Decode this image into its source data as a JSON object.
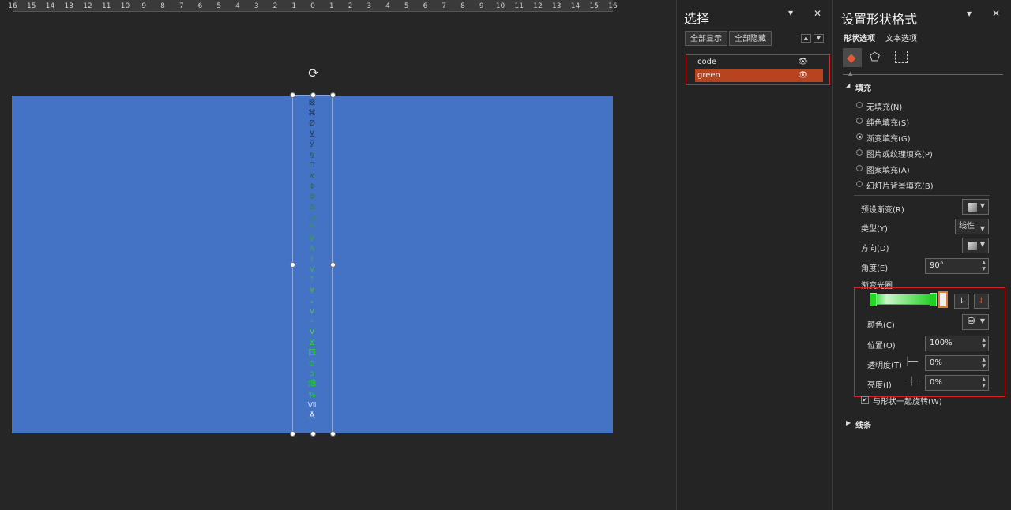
{
  "ruler": {
    "ticks": [
      "16",
      "15",
      "14",
      "13",
      "12",
      "11",
      "10",
      "9",
      "8",
      "7",
      "6",
      "5",
      "4",
      "3",
      "2",
      "1",
      "0",
      "1",
      "2",
      "3",
      "4",
      "5",
      "6",
      "7",
      "8",
      "9",
      "10",
      "11",
      "12",
      "13",
      "14",
      "15",
      "16"
    ]
  },
  "slide": {
    "background_color": "#4472c4",
    "glyphs": [
      {
        "t": "⊠",
        "c": "#1a3355"
      },
      {
        "t": "⌘",
        "c": "#1a3355"
      },
      {
        "t": "Ø",
        "c": "#1a3355"
      },
      {
        "t": "⊻",
        "c": "#1b3d55"
      },
      {
        "t": "Ӱ",
        "c": "#1e4a55"
      },
      {
        "t": "§",
        "c": "#225a55"
      },
      {
        "t": "Π",
        "c": "#245f55"
      },
      {
        "t": "ϰ",
        "c": "#276655"
      },
      {
        "t": "Φ",
        "c": "#2b7055"
      },
      {
        "t": "Φ",
        "c": "#2f7a55"
      },
      {
        "t": "Δ",
        "c": "#338255"
      },
      {
        "t": "□",
        "c": "#378a55"
      },
      {
        "t": "Ⴕ",
        "c": "#3b9455"
      },
      {
        "t": "Ψ",
        "c": "#3f9c55"
      },
      {
        "t": "A",
        "c": "#43a355"
      },
      {
        "t": "Ι",
        "c": "#46a955"
      },
      {
        "t": "V",
        "c": "#4aae55"
      },
      {
        "t": "ᛉ",
        "c": "#4eb455"
      },
      {
        "t": "¥",
        "c": "#52b855"
      },
      {
        "t": "ₓ",
        "c": "#55bd55"
      },
      {
        "t": "v",
        "c": "#58c055"
      },
      {
        "t": "◦",
        "c": "#5bc455"
      },
      {
        "t": "V",
        "c": "#5ec755"
      },
      {
        "t": "Ϫ",
        "c": "#3cc93c"
      },
      {
        "t": "四",
        "c": "#30cc30"
      },
      {
        "t": "⊙",
        "c": "#28cf28"
      },
      {
        "t": "ᴐ",
        "c": "#22d222"
      },
      {
        "t": "畑",
        "c": "#1cd51c"
      },
      {
        "t": "%",
        "c": "#18d818"
      },
      {
        "t": "Ⅶ",
        "c": "#c8d8ff"
      },
      {
        "t": "Å",
        "c": "#e0e8ff"
      }
    ]
  },
  "selection_pane": {
    "title": "选择",
    "dropdown_icon": "▼",
    "close_icon": "✕",
    "show_all": "全部显示",
    "hide_all": "全部隐藏",
    "layers": [
      {
        "name": "code",
        "selected": false
      },
      {
        "name": "green",
        "selected": true
      }
    ],
    "selected_color": "#b8441f"
  },
  "format_pane": {
    "title": "设置形状格式",
    "tabs": [
      "形状选项",
      "文本选项"
    ],
    "fill_section": "填充",
    "fill_options": [
      {
        "label": "无填充(N)",
        "checked": false
      },
      {
        "label": "纯色填充(S)",
        "checked": false
      },
      {
        "label": "渐变填充(G)",
        "checked": true
      },
      {
        "label": "图片或纹理填充(P)",
        "checked": false
      },
      {
        "label": "图案填充(A)",
        "checked": false
      },
      {
        "label": "幻灯片背景填充(B)",
        "checked": false
      }
    ],
    "preset_label": "预设渐变(R)",
    "type_label": "类型(Y)",
    "type_value": "线性",
    "direction_label": "方向(D)",
    "angle_label": "角度(E)",
    "angle_value": "90°",
    "stops_label": "渐变光圈",
    "color_label": "颜色(C)",
    "position_label": "位置(O)",
    "position_value": "100%",
    "transparency_label": "透明度(T)",
    "transparency_value": "0%",
    "brightness_label": "亮度(I)",
    "brightness_value": "0%",
    "rotate_with_shape": "与形状一起旋转(W)",
    "line_section": "线条"
  }
}
